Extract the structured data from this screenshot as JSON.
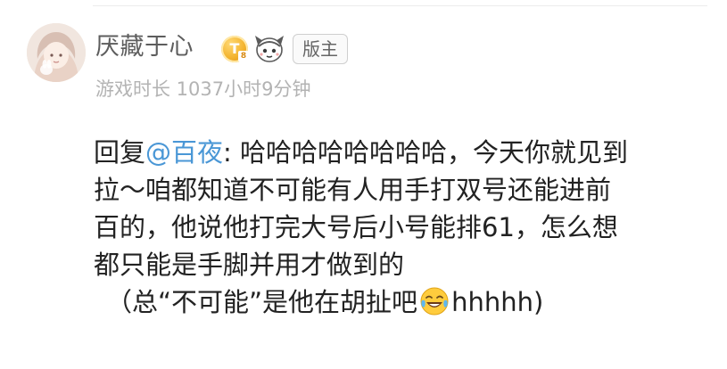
{
  "user": {
    "name": "厌藏于心",
    "level_badge_text": "T",
    "level_badge_sub": "8",
    "role_tag": "版主",
    "playtime": "游戏时长 1037小时9分钟"
  },
  "reply": {
    "prefix": "回复",
    "mention": "@百夜",
    "colon": ":",
    "lines": [
      " 哈哈哈哈哈哈哈哈，今天你就见到",
      "拉～咱都知道不可能有人用手打双号还能进前",
      "百的，他说他打完大号后小号能排61，怎么想",
      "都只能是手脚并用才做到的"
    ],
    "last_line_before_emoji": "（总“不可能”是他在胡扯吧",
    "last_line_after_emoji": "hhhhh)"
  },
  "icons": {
    "avatar": "anime-girl-avatar",
    "level_badge": "level-badge-icon",
    "game_badge": "character-badge-icon",
    "emoji": "tears-of-joy-emoji"
  },
  "colors": {
    "mention": "#4a97d6",
    "username": "#5d5d5d",
    "meta": "#b3b3b3",
    "text": "#222222"
  }
}
